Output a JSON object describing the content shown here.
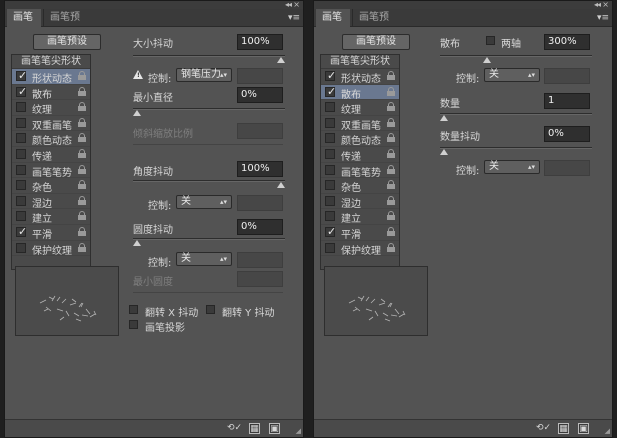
{
  "tabs": [
    "画笔",
    "画笔预设"
  ],
  "window_controls": {
    "collapse": "◂◂",
    "close": "×",
    "menu": "▾≡"
  },
  "left": {
    "presets_button": "画笔预设",
    "list_header": "画笔笔尖形状",
    "items": [
      {
        "label": "形状动态",
        "checked": true,
        "selected": true
      },
      {
        "label": "散布",
        "checked": true,
        "selected": false
      },
      {
        "label": "纹理",
        "checked": false,
        "selected": false
      },
      {
        "label": "双重画笔",
        "checked": false,
        "selected": false
      },
      {
        "label": "颜色动态",
        "checked": false,
        "selected": false
      },
      {
        "label": "传递",
        "checked": false,
        "selected": false
      },
      {
        "label": "画笔笔势",
        "checked": false,
        "selected": false
      },
      {
        "label": "杂色",
        "checked": false,
        "selected": false
      },
      {
        "label": "湿边",
        "checked": false,
        "selected": false
      },
      {
        "label": "建立",
        "checked": false,
        "selected": false
      },
      {
        "label": "平滑",
        "checked": true,
        "selected": false
      },
      {
        "label": "保护纹理",
        "checked": false,
        "selected": false
      }
    ],
    "settings": {
      "size_jitter": {
        "label": "大小抖动",
        "value": "100%",
        "fraction": 1.0
      },
      "size_control": {
        "label": "控制:",
        "value": "钢笔压力"
      },
      "min_diameter": {
        "label": "最小直径",
        "value": "0%",
        "fraction": 0.0
      },
      "tilt_scale": {
        "label": "倾斜缩放比例",
        "value": ""
      },
      "angle_jitter": {
        "label": "角度抖动",
        "value": "100%",
        "fraction": 1.0
      },
      "angle_control": {
        "label": "控制:",
        "value": "关"
      },
      "roundness_jitter": {
        "label": "圆度抖动",
        "value": "0%",
        "fraction": 0.0
      },
      "roundness_control": {
        "label": "控制:",
        "value": "关"
      },
      "min_roundness": {
        "label": "最小圆度",
        "value": ""
      },
      "flip_x": "翻转 X 抖动",
      "flip_y": "翻转 Y 抖动",
      "brush_projection": "画笔投影"
    }
  },
  "right": {
    "presets_button": "画笔预设",
    "list_header": "画笔笔尖形状",
    "items": [
      {
        "label": "形状动态",
        "checked": true,
        "selected": false
      },
      {
        "label": "散布",
        "checked": true,
        "selected": true
      },
      {
        "label": "纹理",
        "checked": false,
        "selected": false
      },
      {
        "label": "双重画笔",
        "checked": false,
        "selected": false
      },
      {
        "label": "颜色动态",
        "checked": false,
        "selected": false
      },
      {
        "label": "传递",
        "checked": false,
        "selected": false
      },
      {
        "label": "画笔笔势",
        "checked": false,
        "selected": false
      },
      {
        "label": "杂色",
        "checked": false,
        "selected": false
      },
      {
        "label": "湿边",
        "checked": false,
        "selected": false
      },
      {
        "label": "建立",
        "checked": false,
        "selected": false
      },
      {
        "label": "平滑",
        "checked": true,
        "selected": false
      },
      {
        "label": "保护纹理",
        "checked": false,
        "selected": false
      }
    ],
    "settings": {
      "scatter": {
        "label": "散布",
        "value": "300%",
        "fraction": 0.3
      },
      "both_axes": "两轴",
      "scatter_control": {
        "label": "控制:",
        "value": "关"
      },
      "count": {
        "label": "数量",
        "value": "1",
        "fraction": 0.0
      },
      "count_jitter": {
        "label": "数量抖动",
        "value": "0%",
        "fraction": 0.0
      },
      "count_control": {
        "label": "控制:",
        "value": "关"
      }
    }
  },
  "footer_icons": [
    "brush-toggle-icon",
    "grid-icon",
    "new-preset-icon"
  ]
}
